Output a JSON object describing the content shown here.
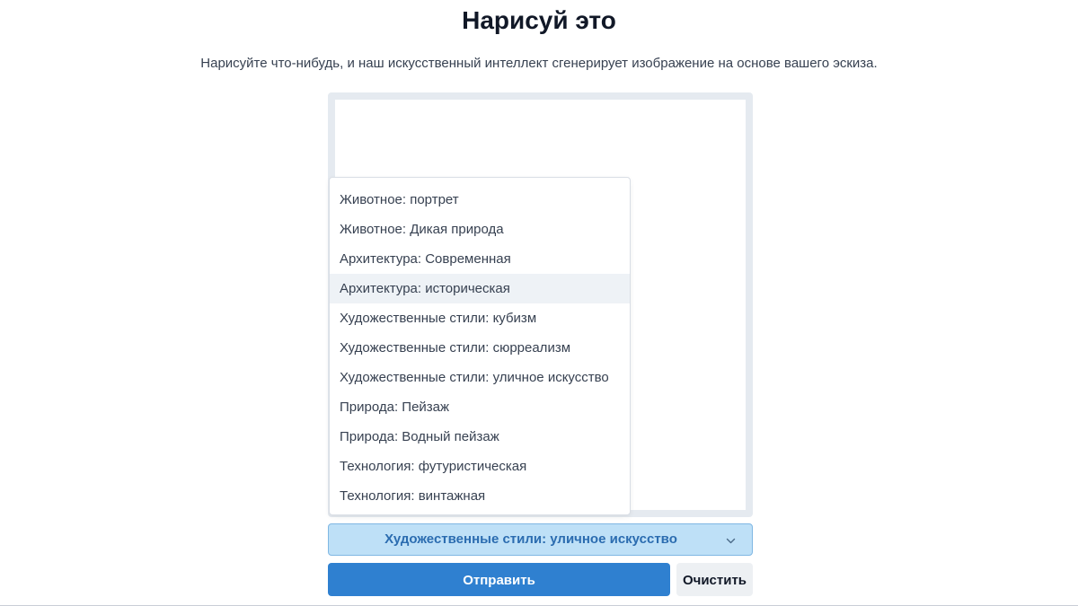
{
  "header": {
    "title": "Нарисуй это",
    "subtitle": "Нарисуйте что-нибудь, и наш искусственный интеллект сгенерирует изображение на основе вашего эскиза."
  },
  "style_select": {
    "selected": "Художественные стили: уличное искусство",
    "highlighted_option": "Архитектура: историческая",
    "options": [
      "Животное: портрет",
      "Животное: Дикая природа",
      "Архитектура: Современная",
      "Архитектура: историческая",
      "Художественные стили: кубизм",
      "Художественные стили: сюрреализм",
      "Художественные стили: уличное искусство",
      "Природа: Пейзаж",
      "Природа: Водный пейзаж",
      "Технология: футуристическая",
      "Технология: винтажная"
    ],
    "icon": "chevron-down-icon"
  },
  "actions": {
    "submit_label": "Отправить",
    "clear_label": "Очистить"
  },
  "colors": {
    "primary": "#2f80d0",
    "select_bg": "#bee0f7",
    "select_text": "#2b6cb0"
  }
}
